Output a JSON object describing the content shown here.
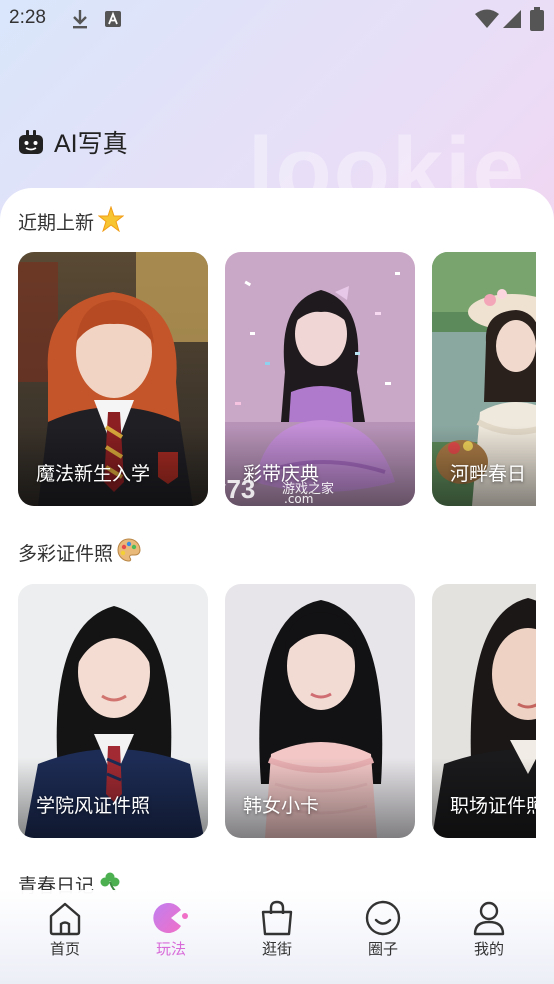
{
  "status_bar": {
    "time": "2:28"
  },
  "header": {
    "title": "AI写真",
    "watermark": "lookie"
  },
  "sections": [
    {
      "title": "近期上新",
      "emoji": "🌟",
      "cards": [
        {
          "label": "魔法新生入学"
        },
        {
          "label": "彩带庆典"
        },
        {
          "label": "河畔春日"
        }
      ]
    },
    {
      "title": "多彩证件照",
      "emoji": "🎨",
      "cards": [
        {
          "label": "学院风证件照"
        },
        {
          "label": "韩女小卡"
        },
        {
          "label": "职场证件照"
        }
      ]
    },
    {
      "title": "青春日记",
      "emoji": "☘️"
    }
  ],
  "watermark": {
    "brand": "k73",
    "sub": "游戏之家",
    "domain": ".com"
  },
  "bottom_nav": [
    {
      "label": "首页",
      "icon": "home-icon"
    },
    {
      "label": "玩法",
      "icon": "play-icon",
      "active": true
    },
    {
      "label": "逛街",
      "icon": "shopping-bag-icon"
    },
    {
      "label": "圈子",
      "icon": "smile-icon"
    },
    {
      "label": "我的",
      "icon": "user-icon"
    }
  ],
  "colors": {
    "active_nav": "#d86bd8",
    "text": "#222222"
  }
}
